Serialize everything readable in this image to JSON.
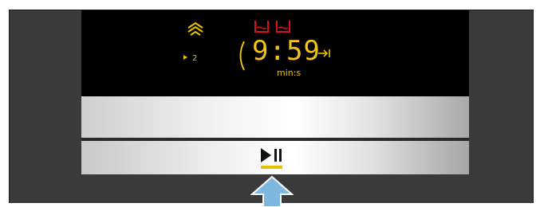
{
  "display": {
    "timer_value": "9:59",
    "timer_unit": "min:s",
    "level_value": "2"
  },
  "icons": {
    "steam": "steam-icon",
    "water_tank": "water-tank-icon",
    "drip_tray": "drip-tray-icon",
    "end_time": "end-time-icon",
    "start_stop": "start-stop-icon",
    "pointer": "pointer-arrow-icon"
  },
  "colors": {
    "display_yellow": "#e8c100",
    "display_red": "#d8131b",
    "indicator_yellow": "#e8c100",
    "pointer_blue": "#7fb8de"
  }
}
